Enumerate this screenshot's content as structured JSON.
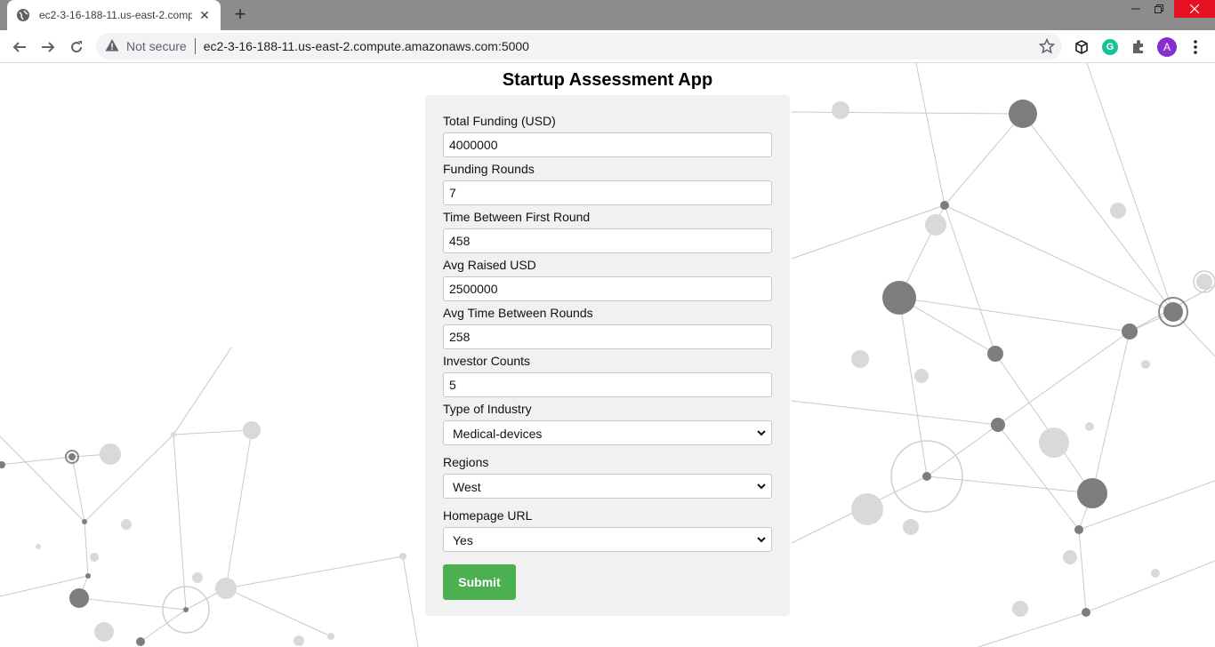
{
  "browser": {
    "tab_title": "ec2-3-16-188-11.us-east-2.comp",
    "security_label": "Not secure",
    "url": "ec2-3-16-188-11.us-east-2.compute.amazonaws.com:5000",
    "profile_initial": "A",
    "grammarly_initial": "G"
  },
  "app": {
    "title": "Startup Assessment App",
    "fields": {
      "total_funding": {
        "label": "Total Funding (USD)",
        "value": "4000000"
      },
      "funding_rounds": {
        "label": "Funding Rounds",
        "value": "7"
      },
      "time_first_round": {
        "label": "Time Between First Round",
        "value": "458"
      },
      "avg_raised": {
        "label": "Avg Raised USD",
        "value": "2500000"
      },
      "avg_time_rounds": {
        "label": "Avg Time Between Rounds",
        "value": "258"
      },
      "investor_counts": {
        "label": "Investor Counts",
        "value": "5"
      }
    },
    "selects": {
      "industry": {
        "label": "Type of Industry",
        "value": "Medical-devices"
      },
      "regions": {
        "label": "Regions",
        "value": "West"
      },
      "homepage": {
        "label": "Homepage URL",
        "value": "Yes"
      }
    },
    "submit_label": "Submit"
  },
  "colors": {
    "submit": "#4caf50",
    "card": "#f1f1f1",
    "tabstrip": "#8c8c8c"
  }
}
